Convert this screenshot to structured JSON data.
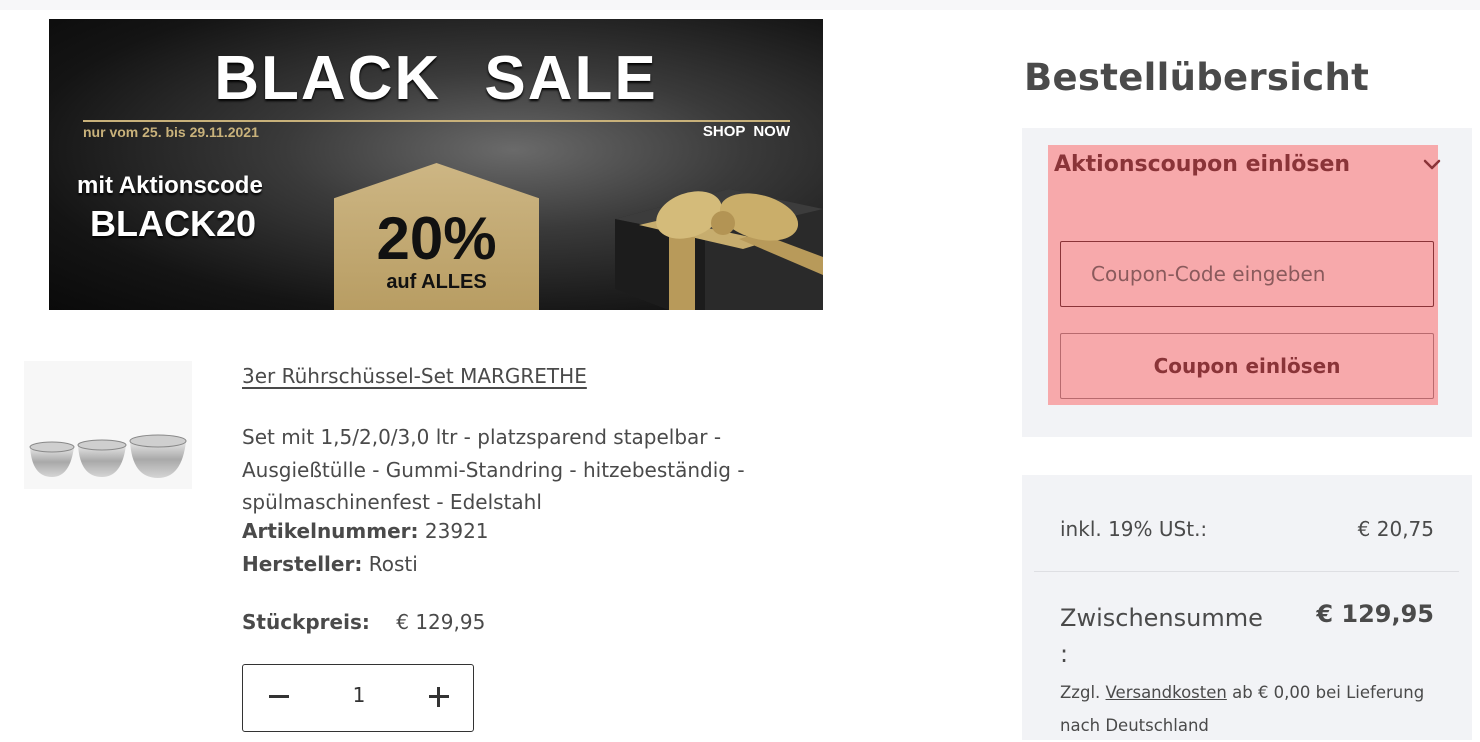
{
  "banner": {
    "title": "BLACK SALE",
    "dates": "nur vom 25. bis 29.11.2021",
    "cta": "SHOP NOW",
    "promo_text": "mit Aktionscode",
    "promo_code": "BLACK20",
    "discount": "20%",
    "discount_sub": "auf ALLES",
    "colors": {
      "gold": "#c8b17a",
      "dark": "#111111"
    }
  },
  "product": {
    "name": "3er Rührschüssel-Set MARGRETHE",
    "description": "Set mit 1,5/2,0/3,0 ltr - platzsparend stapelbar - Ausgießtülle - Gummi-Standring - hitzebeständig - spülmaschinenfest - Edelstahl",
    "sku_label": "Artikelnummer:",
    "sku": "23921",
    "manufacturer_label": "Hersteller:",
    "manufacturer": "Rosti",
    "unit_price_label": "Stückpreis:",
    "unit_price": "€ 129,95",
    "quantity": "1",
    "image_icon": "mixing-bowls-image"
  },
  "summary": {
    "title": "Bestellübersicht",
    "coupon": {
      "heading": "Aktionscoupon einlösen",
      "placeholder": "Coupon-Code eingeben",
      "button": "Coupon einlösen",
      "highlight_color": "#f7a9ab",
      "text_color": "#8a3438"
    },
    "tax_label": "inkl. 19% USt.:",
    "tax_value": "€ 20,75",
    "subtotal_label": "Zwischensumme :",
    "subtotal_value": "€ 129,95",
    "shipping_prefix": "Zzgl.",
    "shipping_link": "Versandkosten",
    "shipping_suffix": "ab € 0,00 bei Lieferung nach Deutschland"
  }
}
